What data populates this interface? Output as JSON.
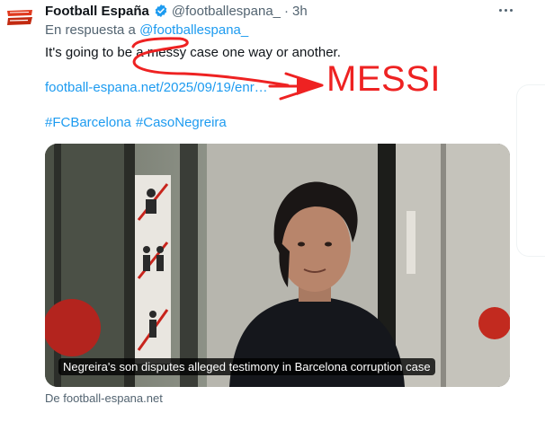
{
  "tweet": {
    "avatar_text": "FOOTBALL ESPAÑA",
    "author_name": "Football España",
    "handle": "@footballespana_",
    "separator": "·",
    "time": "3h",
    "reply_prefix": "En respuesta a",
    "reply_handle": "@footballespana_",
    "text": "It's going to be a messy case one way or another.",
    "link": "football-espana.net/2025/09/19/enr…",
    "hashtags": [
      "#FCBarcelona",
      "#CasoNegreira"
    ]
  },
  "card": {
    "caption": "Negreira's son disputes alleged testimony in Barcelona corruption case",
    "source": "De football-espana.net"
  },
  "annotation": {
    "label": "MESSI",
    "color": "#ee2222"
  },
  "colors": {
    "link": "#1d9bf0",
    "secondary_text": "#536471",
    "verified": "#1d9bf0"
  }
}
